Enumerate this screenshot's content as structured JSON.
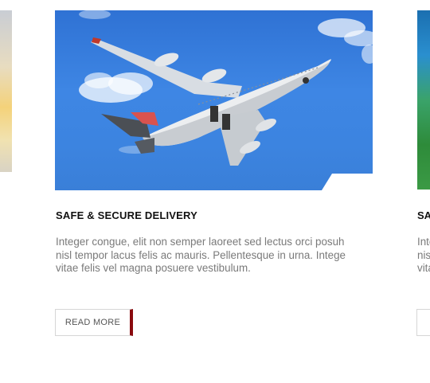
{
  "cards": {
    "main": {
      "image_alt": "airplane-in-sky",
      "title": "SAFE & SECURE DELIVERY",
      "text": "Integer congue, elit non semper laoreet sed lectus orci posuh\nnisl tempor lacus felis ac mauris. Pellentesque in urna. Intege\nvitae felis vel magna posuere vestibulum.",
      "button_label": "READ MORE"
    },
    "right": {
      "title": "SA",
      "text": "Inte\nnis\nvita"
    }
  },
  "colors": {
    "button_accent": "#8a0a0e",
    "title": "#111111",
    "body_text": "#7a7a7a"
  }
}
